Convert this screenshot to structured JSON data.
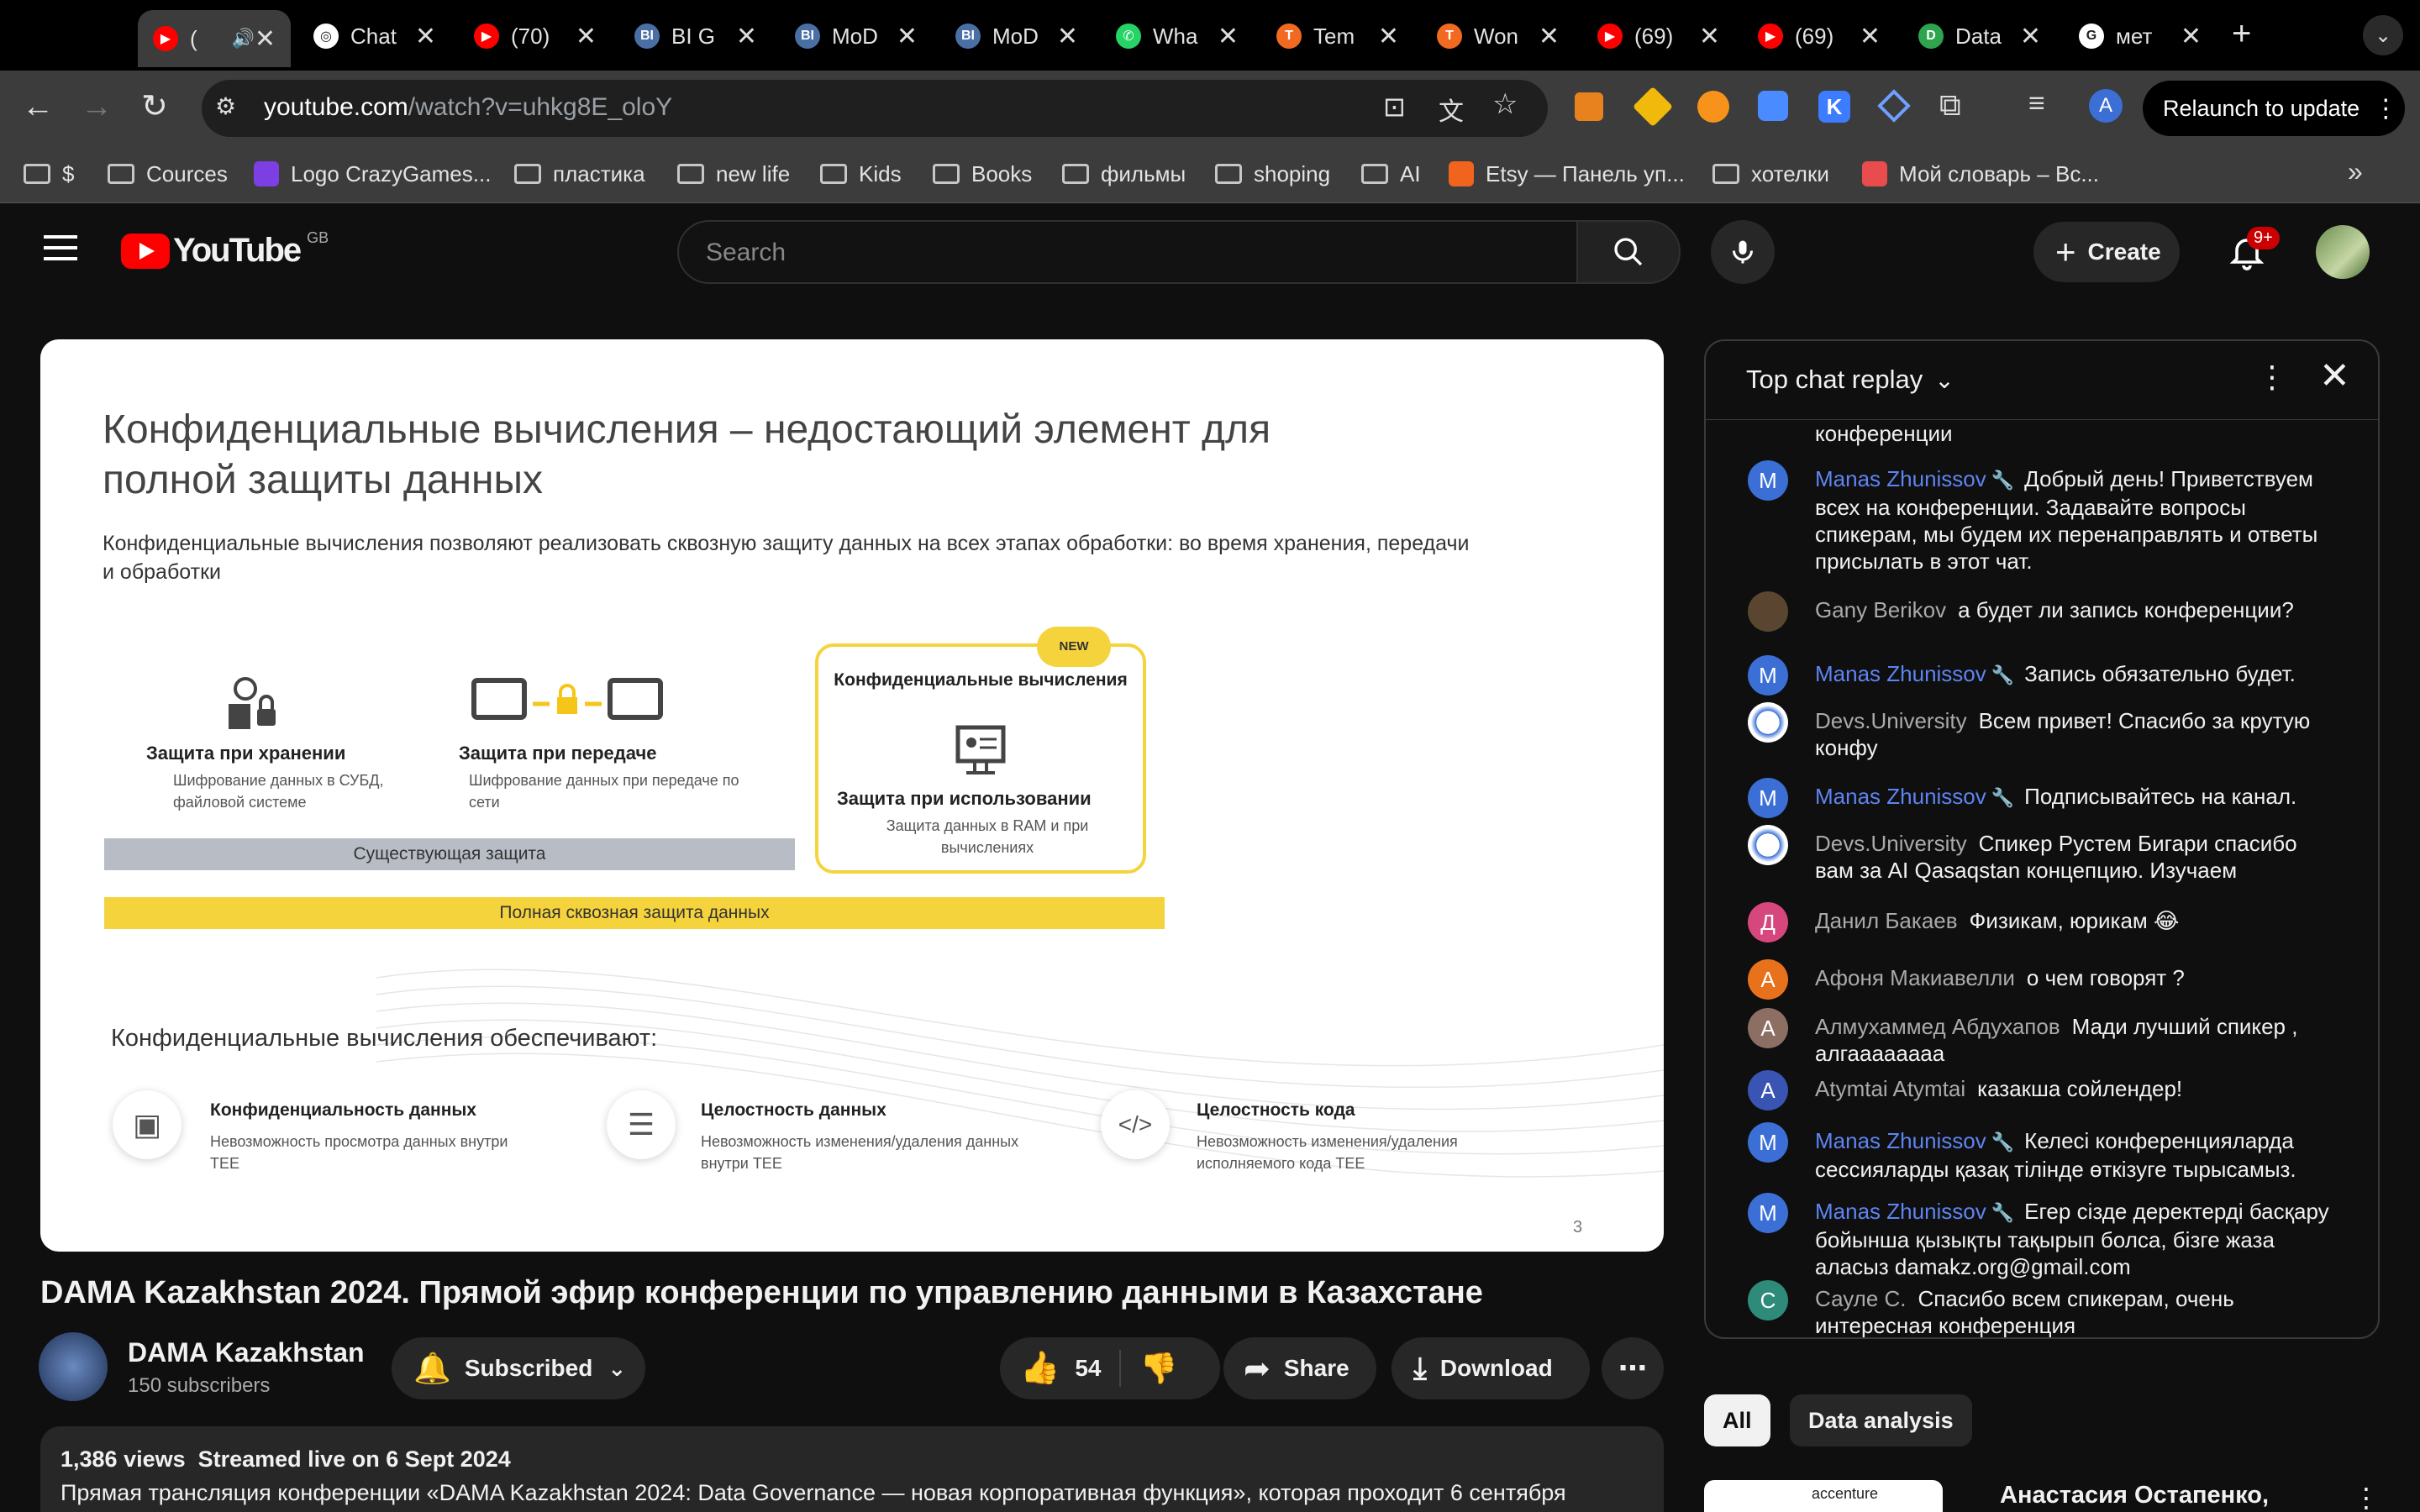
{
  "browser": {
    "tabs": [
      {
        "label": "(",
        "color": "#ff0000",
        "glyph": "▶"
      },
      {
        "label": "Chat",
        "color": "#ffffff",
        "glyph": "◎"
      },
      {
        "label": "(70)",
        "color": "#ff0000",
        "glyph": "▶"
      },
      {
        "label": "BI G",
        "color": "#4a6fa5",
        "glyph": "BI"
      },
      {
        "label": "MoD",
        "color": "#4a6fa5",
        "glyph": "BI"
      },
      {
        "label": "MoD",
        "color": "#4a6fa5",
        "glyph": "BI"
      },
      {
        "label": "Wha",
        "color": "#25d366",
        "glyph": "✆"
      },
      {
        "label": "Tem",
        "color": "#f26a21",
        "glyph": "T"
      },
      {
        "label": "Won",
        "color": "#f26a21",
        "glyph": "T"
      },
      {
        "label": "(69)",
        "color": "#ff0000",
        "glyph": "▶"
      },
      {
        "label": "(69)",
        "color": "#ff0000",
        "glyph": "▶"
      },
      {
        "label": "Data",
        "color": "#2ea44f",
        "glyph": "D"
      },
      {
        "label": "мет",
        "color": "#ffffff",
        "glyph": "G"
      }
    ],
    "url_host": "youtube.com",
    "url_path": "/watch?v=uhkg8E_oloY",
    "relaunch": "Relaunch to update",
    "profile_letter": "A",
    "bookmarks": [
      {
        "label": "$",
        "type": "folder"
      },
      {
        "label": "Cources",
        "type": "folder"
      },
      {
        "label": "Logo CrazyGames...",
        "type": "site",
        "color": "#7b3fe4"
      },
      {
        "label": "пластика",
        "type": "folder"
      },
      {
        "label": "new life",
        "type": "folder"
      },
      {
        "label": "Kids",
        "type": "folder"
      },
      {
        "label": "Books",
        "type": "folder"
      },
      {
        "label": "фильмы",
        "type": "folder"
      },
      {
        "label": "shoping",
        "type": "folder"
      },
      {
        "label": "AI",
        "type": "folder"
      },
      {
        "label": "Etsy — Панель уп...",
        "type": "site",
        "color": "#f1641e"
      },
      {
        "label": "хотелки",
        "type": "folder"
      },
      {
        "label": "Мой словарь – Вс...",
        "type": "site",
        "color": "#e84c4c"
      }
    ]
  },
  "yt": {
    "logo_text": "YouTube",
    "region": "GB",
    "search_placeholder": "Search",
    "create": "Create",
    "notif_count": "9+"
  },
  "slide": {
    "title": "Конфиденциальные вычисления – недостающий элемент для полной защиты данных",
    "subtitle": "Конфиденциальные вычисления позволяют реализовать сквозную защиту данных на всех этапах обработки: во время хранения, передачи и обработки",
    "col1_title": "Защита при хранении",
    "col1_text": "Шифрование данных в СУБД, файловой системе",
    "col2_title": "Защита при передаче",
    "col2_text": "Шифрование данных при передаче по сети",
    "badge": "NEW",
    "col3_header": "Конфиденциальные вычисления",
    "col3_title": "Защита при использовании",
    "col3_text": "Защита данных в RAM и при вычислениях",
    "existing": "Существующая защита",
    "full": "Полная сквозная защита данных",
    "provides": "Конфиденциальные вычисления обеспечивают:",
    "f1_title": "Конфиденциальность данных",
    "f1_text": "Невозможность просмотра данных внутри TEE",
    "f2_title": "Целостность данных",
    "f2_text": "Невозможность изменения/удаления данных внутри TEE",
    "f3_title": "Целостность кода",
    "f3_text": "Невозможность изменения/удаления исполняемого кода TEE",
    "page": "3"
  },
  "video": {
    "title": "DAMA Kazakhstan 2024. Прямой эфир конференции по управлению данными в Казахстане",
    "channel": "DAMA Kazakhstan",
    "subscribers": "150 subscribers",
    "subscribed": "Subscribed",
    "likes": "54",
    "share": "Share",
    "download": "Download",
    "views": "1,386 views  Streamed live on 6 Sept 2024",
    "description": "Прямая трансляция конференции «DAMA Kazakhstan 2024: Data Governance — новая корпоративная функция», которая проходит 6 сентября"
  },
  "chat": {
    "title": "Top chat replay",
    "cut_text": "конференции",
    "messages": [
      {
        "author": "Manas Zhunissov",
        "mod": true,
        "avatar": "M",
        "color": "#3b6fd6",
        "text": "Добрый день! Приветствуем всех на конференции. Задавайте вопросы спикерам, мы будем их перенаправлять и ответы присылать в этот чат."
      },
      {
        "author": "Gany Berikov",
        "mod": false,
        "avatar": "",
        "color": "#5a4630",
        "text": "а будет ли запись конференции?"
      },
      {
        "author": "Manas Zhunissov",
        "mod": true,
        "avatar": "M",
        "color": "#3b6fd6",
        "text": "Запись обязательно будет."
      },
      {
        "author": "Devs.University",
        "mod": false,
        "avatar": "",
        "color": "#ffffff",
        "text": "Всем привет! Спасибо за крутую конфу"
      },
      {
        "author": "Manas Zhunissov",
        "mod": true,
        "avatar": "M",
        "color": "#3b6fd6",
        "text": "Подписывайтесь на канал."
      },
      {
        "author": "Devs.University",
        "mod": false,
        "avatar": "",
        "color": "#ffffff",
        "text": "Спикер Рустем Бигари спасибо вам за AI Qasaqstan концепцию. Изучаем"
      },
      {
        "author": "Данил Бакаев",
        "mod": false,
        "avatar": "Д",
        "color": "#d6477e",
        "text": "Физикам, юрикам 😂"
      },
      {
        "author": "Афоня Макиавелли",
        "mod": false,
        "avatar": "А",
        "color": "#e8711c",
        "text": "о чем говорят ?"
      },
      {
        "author": "Алмухаммед Абдухапов",
        "mod": false,
        "avatar": "А",
        "color": "#8d6e63",
        "text": "Мади лучший спикер , алгаааааааа"
      },
      {
        "author": "Atymtai Atymtai",
        "mod": false,
        "avatar": "A",
        "color": "#3954b3",
        "text": "казакша сойлендер!"
      },
      {
        "author": "Manas Zhunissov",
        "mod": true,
        "avatar": "M",
        "color": "#3b6fd6",
        "text": "Келесі конференцияларда сессияларды қазақ тілінде өткізуге тырысамыз."
      },
      {
        "author": "Manas Zhunissov",
        "mod": true,
        "avatar": "M",
        "color": "#3b6fd6",
        "text": "Егер сізде деректерді басқару бойынша қызықты тақырып болса, бізге жаза аласыз damakz.org@gmail.com"
      },
      {
        "author": "Сауле С.",
        "mod": false,
        "avatar": "С",
        "color": "#2e8b7a",
        "text": "Спасибо всем спикерам, очень интересная конференция"
      }
    ]
  },
  "filters": [
    "All",
    "Data analysis"
  ],
  "related": {
    "title": "Анастасия Остапенко,",
    "thumb_text": "accenture"
  }
}
